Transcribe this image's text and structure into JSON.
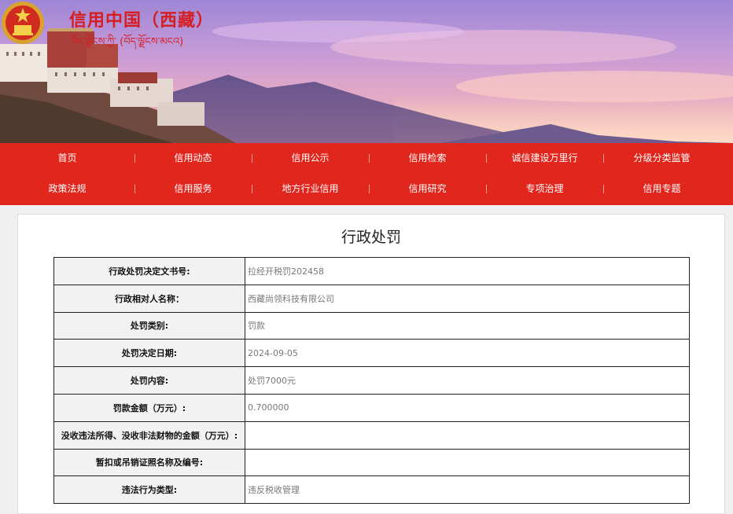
{
  "header": {
    "title": "信用中国（西藏）",
    "subtitle": "བོད་ལྗོངས་ཀྱི་ (བོད་ལྗོངས་མངའ)"
  },
  "nav": {
    "row1": [
      "首页",
      "信用动态",
      "信用公示",
      "信用检索",
      "诚信建设万里行",
      "分级分类监管"
    ],
    "row2": [
      "政策法规",
      "信用服务",
      "地方行业信用",
      "信用研究",
      "专项治理",
      "信用专题"
    ]
  },
  "page": {
    "title": "行政处罚"
  },
  "record": [
    {
      "label": "行政处罚决定文书号:",
      "value": "拉经开税罚202458"
    },
    {
      "label": "行政相对人名称：",
      "value": "西藏尚领科技有限公司"
    },
    {
      "label": "处罚类别:",
      "value": "罚款"
    },
    {
      "label": "处罚决定日期:",
      "value": "2024-09-05"
    },
    {
      "label": "处罚内容:",
      "value": "处罚7000元"
    },
    {
      "label": "罚款金额（万元）:",
      "value": "0.700000"
    },
    {
      "label": "没收违法所得、没收非法财物的金额（万元）:",
      "value": ""
    },
    {
      "label": "暂扣或吊销证照名称及编号:",
      "value": ""
    },
    {
      "label": "违法行为类型:",
      "value": "违反税收管理"
    }
  ],
  "colors": {
    "brand_red": "#e1261d",
    "title_red": "#d61d20"
  }
}
